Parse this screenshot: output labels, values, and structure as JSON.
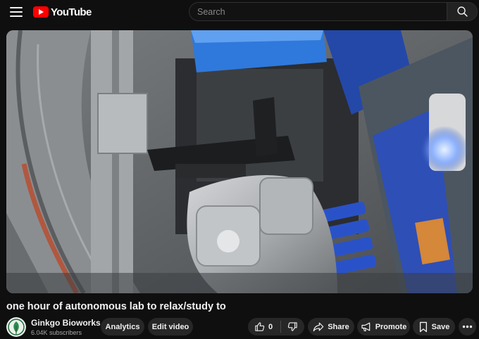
{
  "header": {
    "logo_text": "YouTube",
    "search_placeholder": "Search"
  },
  "video": {
    "title": "one hour of autonomous lab to relax/study to"
  },
  "channel": {
    "name": "Ginkgo Bioworks",
    "subscribers": "6.04K subscribers"
  },
  "actions": {
    "analytics": "Analytics",
    "edit_video": "Edit video",
    "like_count": "0",
    "share": "Share",
    "promote": "Promote",
    "save": "Save"
  },
  "icons": {
    "menu": "menu-icon",
    "search": "search-icon",
    "like": "thumb-up-icon",
    "dislike": "thumb-down-icon",
    "share": "share-arrow-icon",
    "promote": "megaphone-icon",
    "save": "bookmark-icon",
    "more": "more-horiz-icon"
  },
  "colors": {
    "background": "#0f0f0f",
    "brand_red": "#ff0000",
    "pill_bg": "#272727",
    "text": "#f1f1f1",
    "subtext": "#aaaaaa"
  }
}
